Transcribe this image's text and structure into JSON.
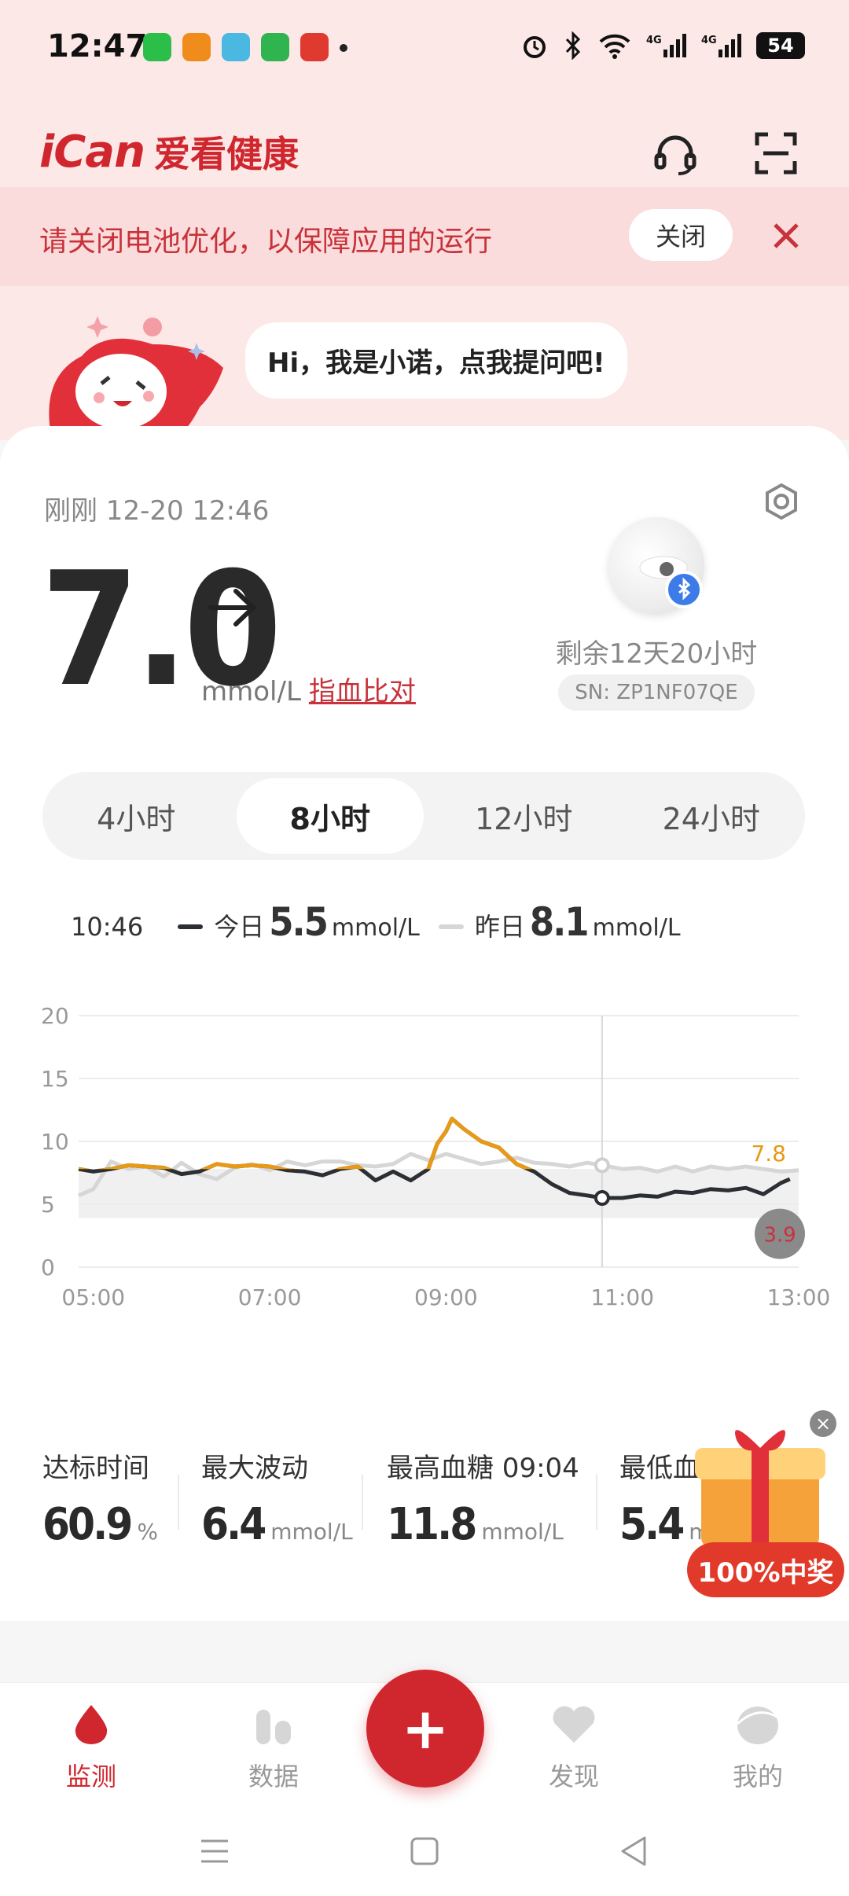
{
  "status_bar": {
    "time": "12:47",
    "battery": "54"
  },
  "header": {
    "brand_logo": "iCan",
    "brand_name": "爱看健康"
  },
  "notice": {
    "text": "请关闭电池优化，以保障应用的运行",
    "close_label": "关闭"
  },
  "assistant": {
    "bubble": "Hi，我是小诺，点我提问吧!"
  },
  "reading": {
    "updated": "刚刚 12-20 12:46",
    "value": "7.0",
    "unit": "mmol/L",
    "calibrate_link": "指血比对",
    "remaining": "剩余12天20小时",
    "sn": "SN: ZP1NF07QE"
  },
  "tabs": [
    {
      "label": "4小时",
      "active": false
    },
    {
      "label": "8小时",
      "active": true
    },
    {
      "label": "12小时",
      "active": false
    },
    {
      "label": "24小时",
      "active": false
    }
  ],
  "legend": {
    "time": "10:46",
    "today_label": "今日",
    "today_value": "5.5",
    "yesterday_label": "昨日",
    "yesterday_value": "8.1",
    "unit": "mmol/L"
  },
  "chart_data": {
    "type": "line",
    "x_ticks": [
      "05:00",
      "07:00",
      "09:00",
      "11:00",
      "13:00"
    ],
    "y_ticks": [
      0,
      5,
      10,
      15,
      20
    ],
    "xlim": [
      4.833,
      13.0
    ],
    "ylim": [
      0,
      20
    ],
    "target_range": [
      3.9,
      7.8
    ],
    "target_range_labels": {
      "high": "7.8",
      "low": "3.9"
    },
    "cursor_time": 10.77,
    "colors": {
      "today": "#2b2f33",
      "high": "#e89a16",
      "yesterday": "#d6d6d6",
      "band": "#f0f0f0"
    },
    "series": [
      {
        "name": "今日",
        "x": [
          4.833,
          5.0,
          5.2,
          5.4,
          5.6,
          5.8,
          6.0,
          6.2,
          6.4,
          6.6,
          6.8,
          7.0,
          7.2,
          7.4,
          7.6,
          7.8,
          8.0,
          8.2,
          8.4,
          8.6,
          8.8,
          8.9,
          9.0,
          9.067,
          9.2,
          9.4,
          9.6,
          9.8,
          10.0,
          10.2,
          10.4,
          10.6,
          10.77,
          11.0,
          11.2,
          11.4,
          11.6,
          11.8,
          12.0,
          12.2,
          12.4,
          12.6,
          12.8,
          12.9
        ],
        "values": [
          7.8,
          7.6,
          7.8,
          8.1,
          8.0,
          7.9,
          7.4,
          7.6,
          8.2,
          8.0,
          8.1,
          8.0,
          7.7,
          7.6,
          7.3,
          7.8,
          8.0,
          6.9,
          7.6,
          6.9,
          7.8,
          9.8,
          10.8,
          11.8,
          11.0,
          10.0,
          9.5,
          8.2,
          7.6,
          6.6,
          5.9,
          5.7,
          5.5,
          5.5,
          5.7,
          5.6,
          6.0,
          5.9,
          6.2,
          6.1,
          6.3,
          5.8,
          6.7,
          7.0
        ]
      },
      {
        "name": "昨日",
        "x": [
          4.833,
          5.0,
          5.2,
          5.4,
          5.6,
          5.8,
          6.0,
          6.2,
          6.4,
          6.6,
          6.8,
          7.0,
          7.2,
          7.4,
          7.6,
          7.8,
          8.0,
          8.2,
          8.4,
          8.6,
          8.8,
          9.0,
          9.2,
          9.4,
          9.6,
          9.8,
          10.0,
          10.2,
          10.4,
          10.6,
          10.77,
          11.0,
          11.2,
          11.4,
          11.6,
          11.8,
          12.0,
          12.2,
          12.4,
          12.6,
          12.8,
          13.0
        ],
        "values": [
          5.7,
          6.2,
          8.4,
          7.8,
          8.0,
          7.2,
          8.3,
          7.4,
          7.0,
          7.9,
          8.2,
          7.7,
          8.4,
          8.1,
          8.4,
          8.4,
          8.1,
          8.0,
          8.2,
          9.0,
          8.5,
          9.0,
          8.6,
          8.2,
          8.4,
          8.7,
          8.3,
          8.2,
          8.0,
          8.3,
          8.1,
          7.8,
          7.9,
          7.6,
          8.0,
          7.6,
          8.0,
          7.8,
          8.0,
          7.8,
          7.6,
          7.7
        ]
      }
    ]
  },
  "stats": [
    {
      "label": "达标时间",
      "value": "60.9",
      "unit": "%"
    },
    {
      "label": "最大波动",
      "value": "6.4",
      "unit": "mmol/L"
    },
    {
      "label": "最高血糖 09:04",
      "value": "11.8",
      "unit": "mmol/L"
    },
    {
      "label": "最低血糖 10:52",
      "value": "5.4",
      "unit": "mmol/L"
    }
  ],
  "promo": {
    "label": "100%中奖"
  },
  "nav": [
    {
      "label": "监测",
      "active": true,
      "icon": "drop-icon"
    },
    {
      "label": "数据",
      "active": false,
      "icon": "data-icon"
    },
    {
      "label": "发现",
      "active": false,
      "icon": "heart-icon"
    },
    {
      "label": "我的",
      "active": false,
      "icon": "profile-icon"
    }
  ],
  "fab": {
    "label": "+"
  }
}
